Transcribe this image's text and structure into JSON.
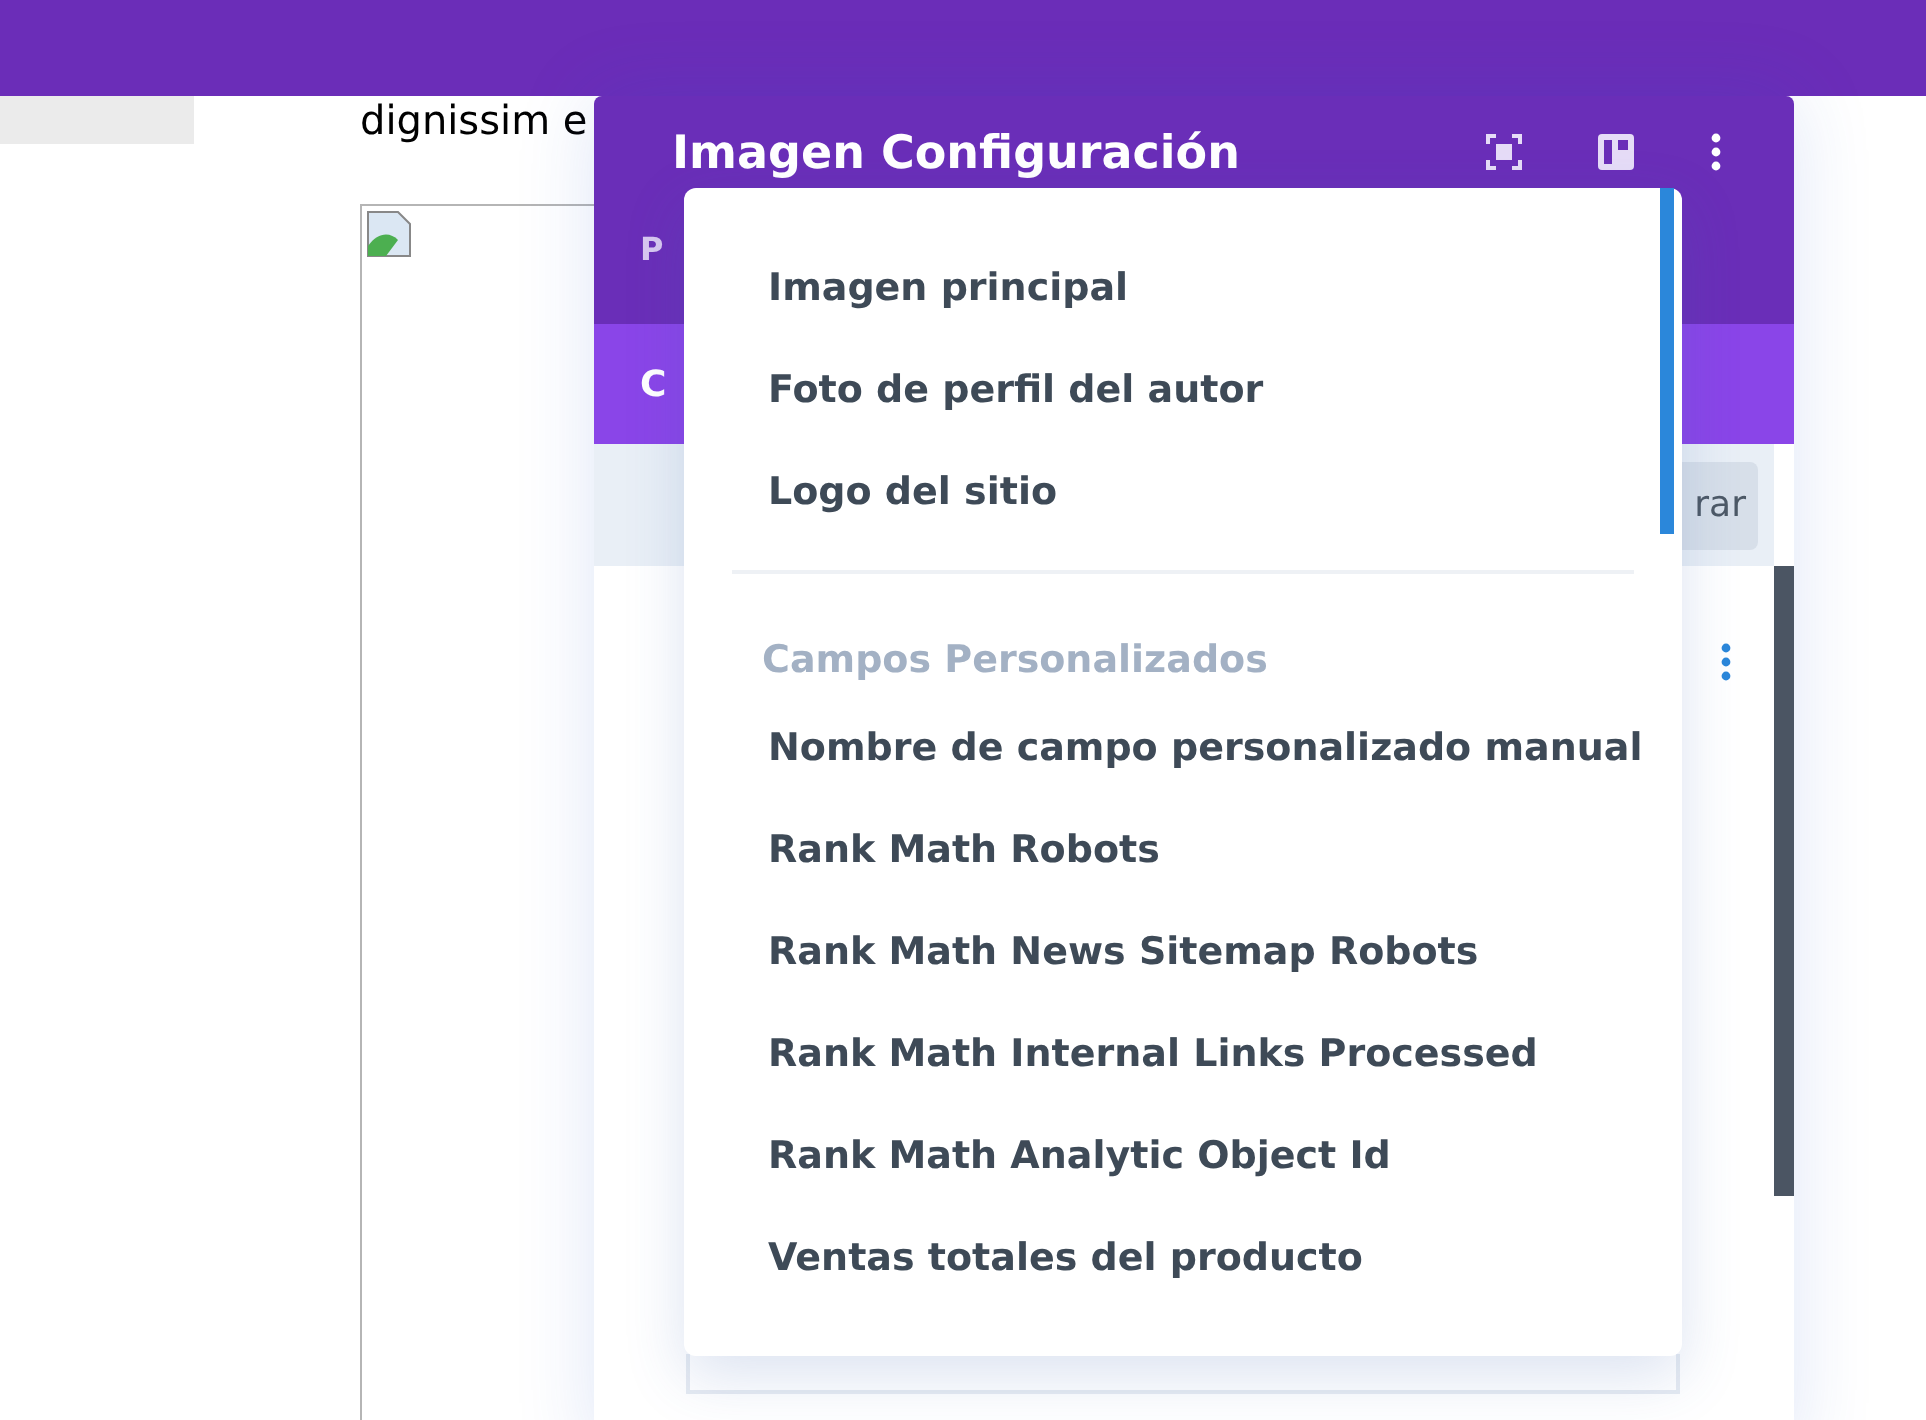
{
  "page": {
    "body_text": "dignissim e"
  },
  "modal": {
    "title": "Imagen Configuración",
    "subtitle": "P",
    "tab": "C",
    "toolbar_button": "rar"
  },
  "dropdown": {
    "items": [
      {
        "kind": "option",
        "label": "Imagen principal"
      },
      {
        "kind": "option",
        "label": "Foto de perfil del autor"
      },
      {
        "kind": "option",
        "label": "Logo del sitio"
      },
      {
        "kind": "divider"
      },
      {
        "kind": "heading",
        "label": "Campos Personalizados"
      },
      {
        "kind": "option",
        "label": "Nombre de campo personalizado manual"
      },
      {
        "kind": "option",
        "label": "Rank Math Robots"
      },
      {
        "kind": "option",
        "label": "Rank Math News Sitemap Robots"
      },
      {
        "kind": "option",
        "label": "Rank Math Internal Links Processed"
      },
      {
        "kind": "option",
        "label": "Rank Math Analytic Object Id"
      },
      {
        "kind": "option",
        "label": "Ventas totales del producto"
      }
    ]
  }
}
